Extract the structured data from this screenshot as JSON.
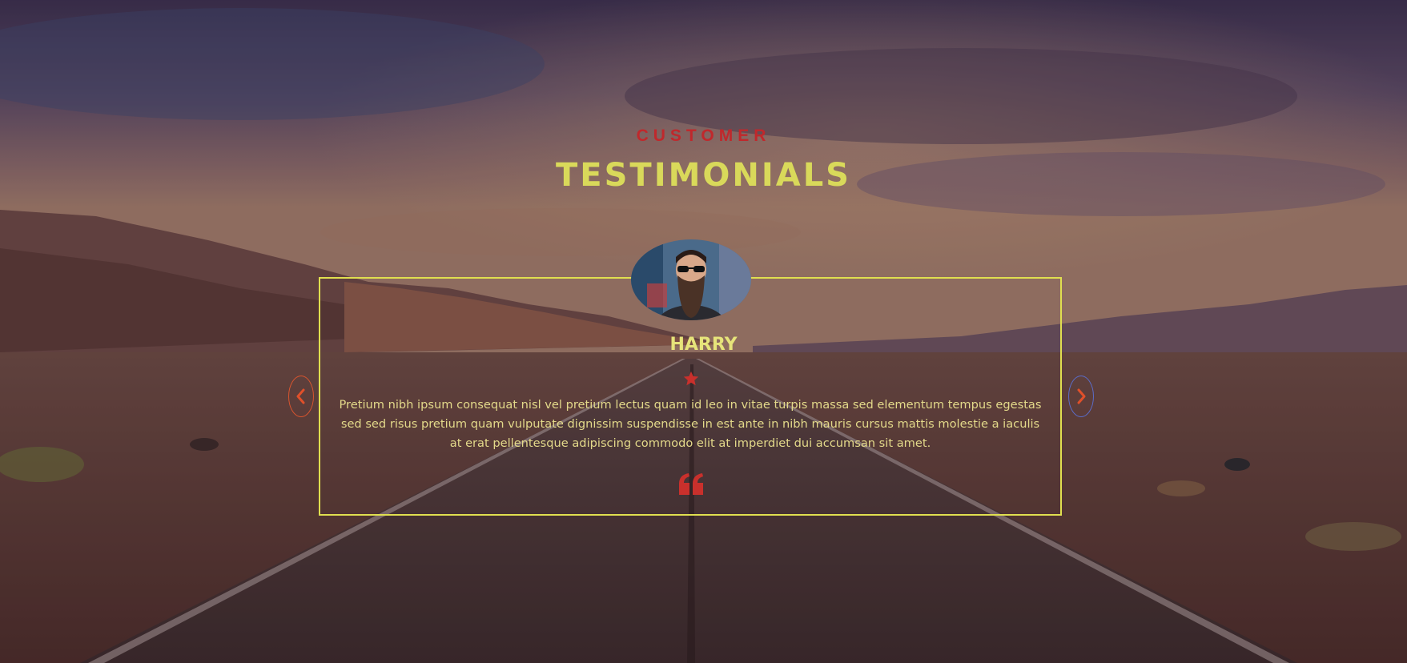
{
  "section": {
    "eyebrow": "CUSTOMER",
    "title": "TESTIMONIALS"
  },
  "testimonial": {
    "name": "HARRY",
    "rating_stars": 1,
    "text": "Pretium nibh ipsum consequat nisl vel pretium lectus quam id leo in vitae turpis massa sed elementum tempus egestas sed sed risus pretium quam vulputate dignissim suspendisse in est ante in nibh mauris cursus mattis molestie a iaculis at erat pellentesque adipiscing commodo elit at imperdiet dui accumsan sit amet.",
    "avatar_icon": "bearded-man-sunglasses-photo",
    "quote_icon": "quote-icon"
  },
  "navigation": {
    "prev_icon": "chevron-left-icon",
    "next_icon": "chevron-right-icon"
  },
  "colors": {
    "eyebrow": "#c0282c",
    "title": "#d9d95a",
    "card_border": "#e0df4f",
    "name": "#e6e47a",
    "body_text": "#e3d98a",
    "accent_red": "#c9302c",
    "arrow_icon": "#e0502a",
    "arrow_prev_ring": "#d9542e",
    "arrow_next_ring": "#5b6cc8"
  }
}
